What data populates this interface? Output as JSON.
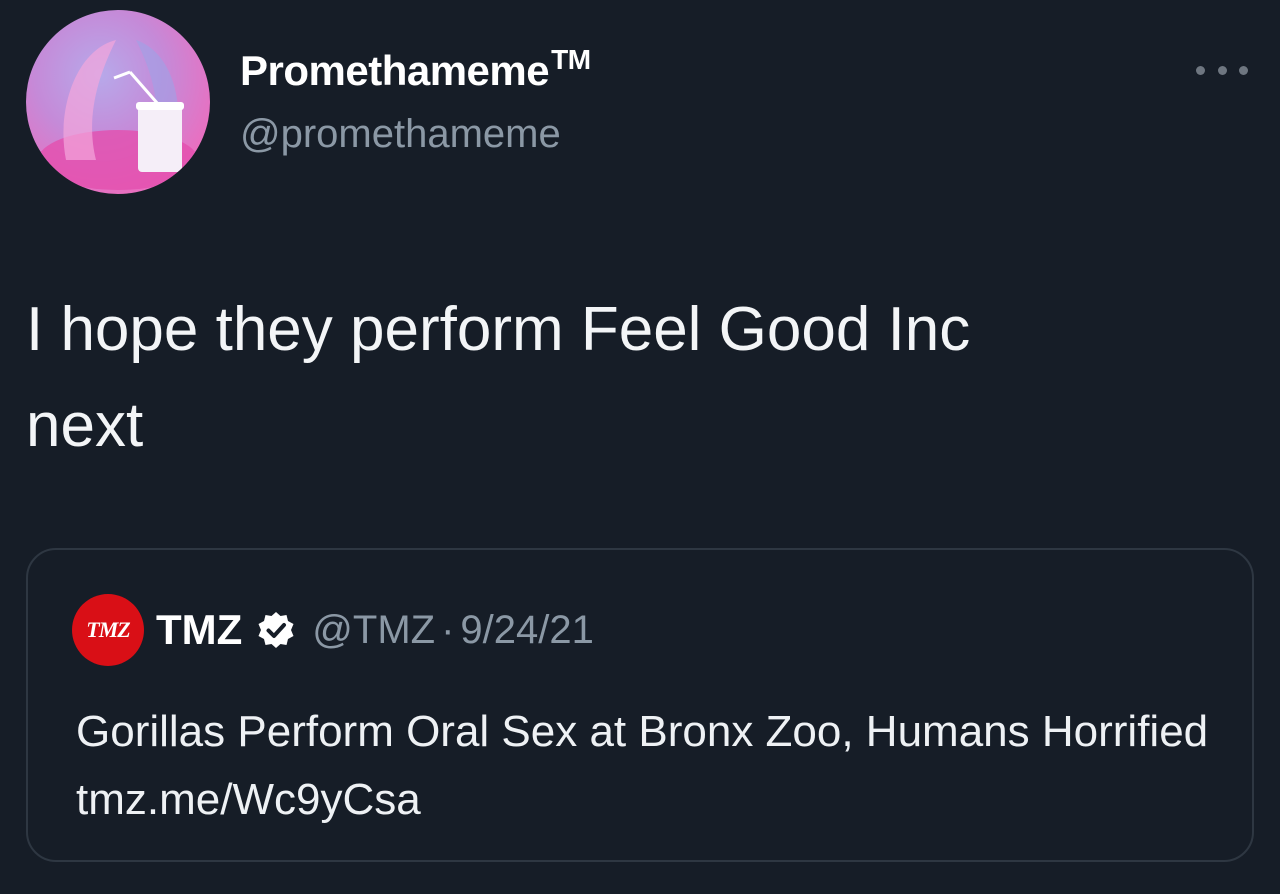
{
  "tweet": {
    "display_name": "Promethameme",
    "trademark": "TM",
    "handle": "@promethameme",
    "text": "I hope they perform Feel Good Inc\nnext",
    "avatar_icon": "avatar-lean-cup-icon",
    "more_icon": "more-options-icon"
  },
  "quote": {
    "logo_text": "TMZ",
    "display_name": "TMZ",
    "verified_icon": "verified-badge-icon",
    "handle": "@TMZ",
    "separator": "·",
    "date": "9/24/21",
    "text": "Gorillas Perform Oral Sex at Bronx Zoo, Humans Horrified tmz.me/Wc9yCsa"
  },
  "colors": {
    "background": "#161d27",
    "text": "#ffffff",
    "muted": "#8b98a5",
    "border": "#2e3742",
    "tmz_red": "#d90f16"
  }
}
